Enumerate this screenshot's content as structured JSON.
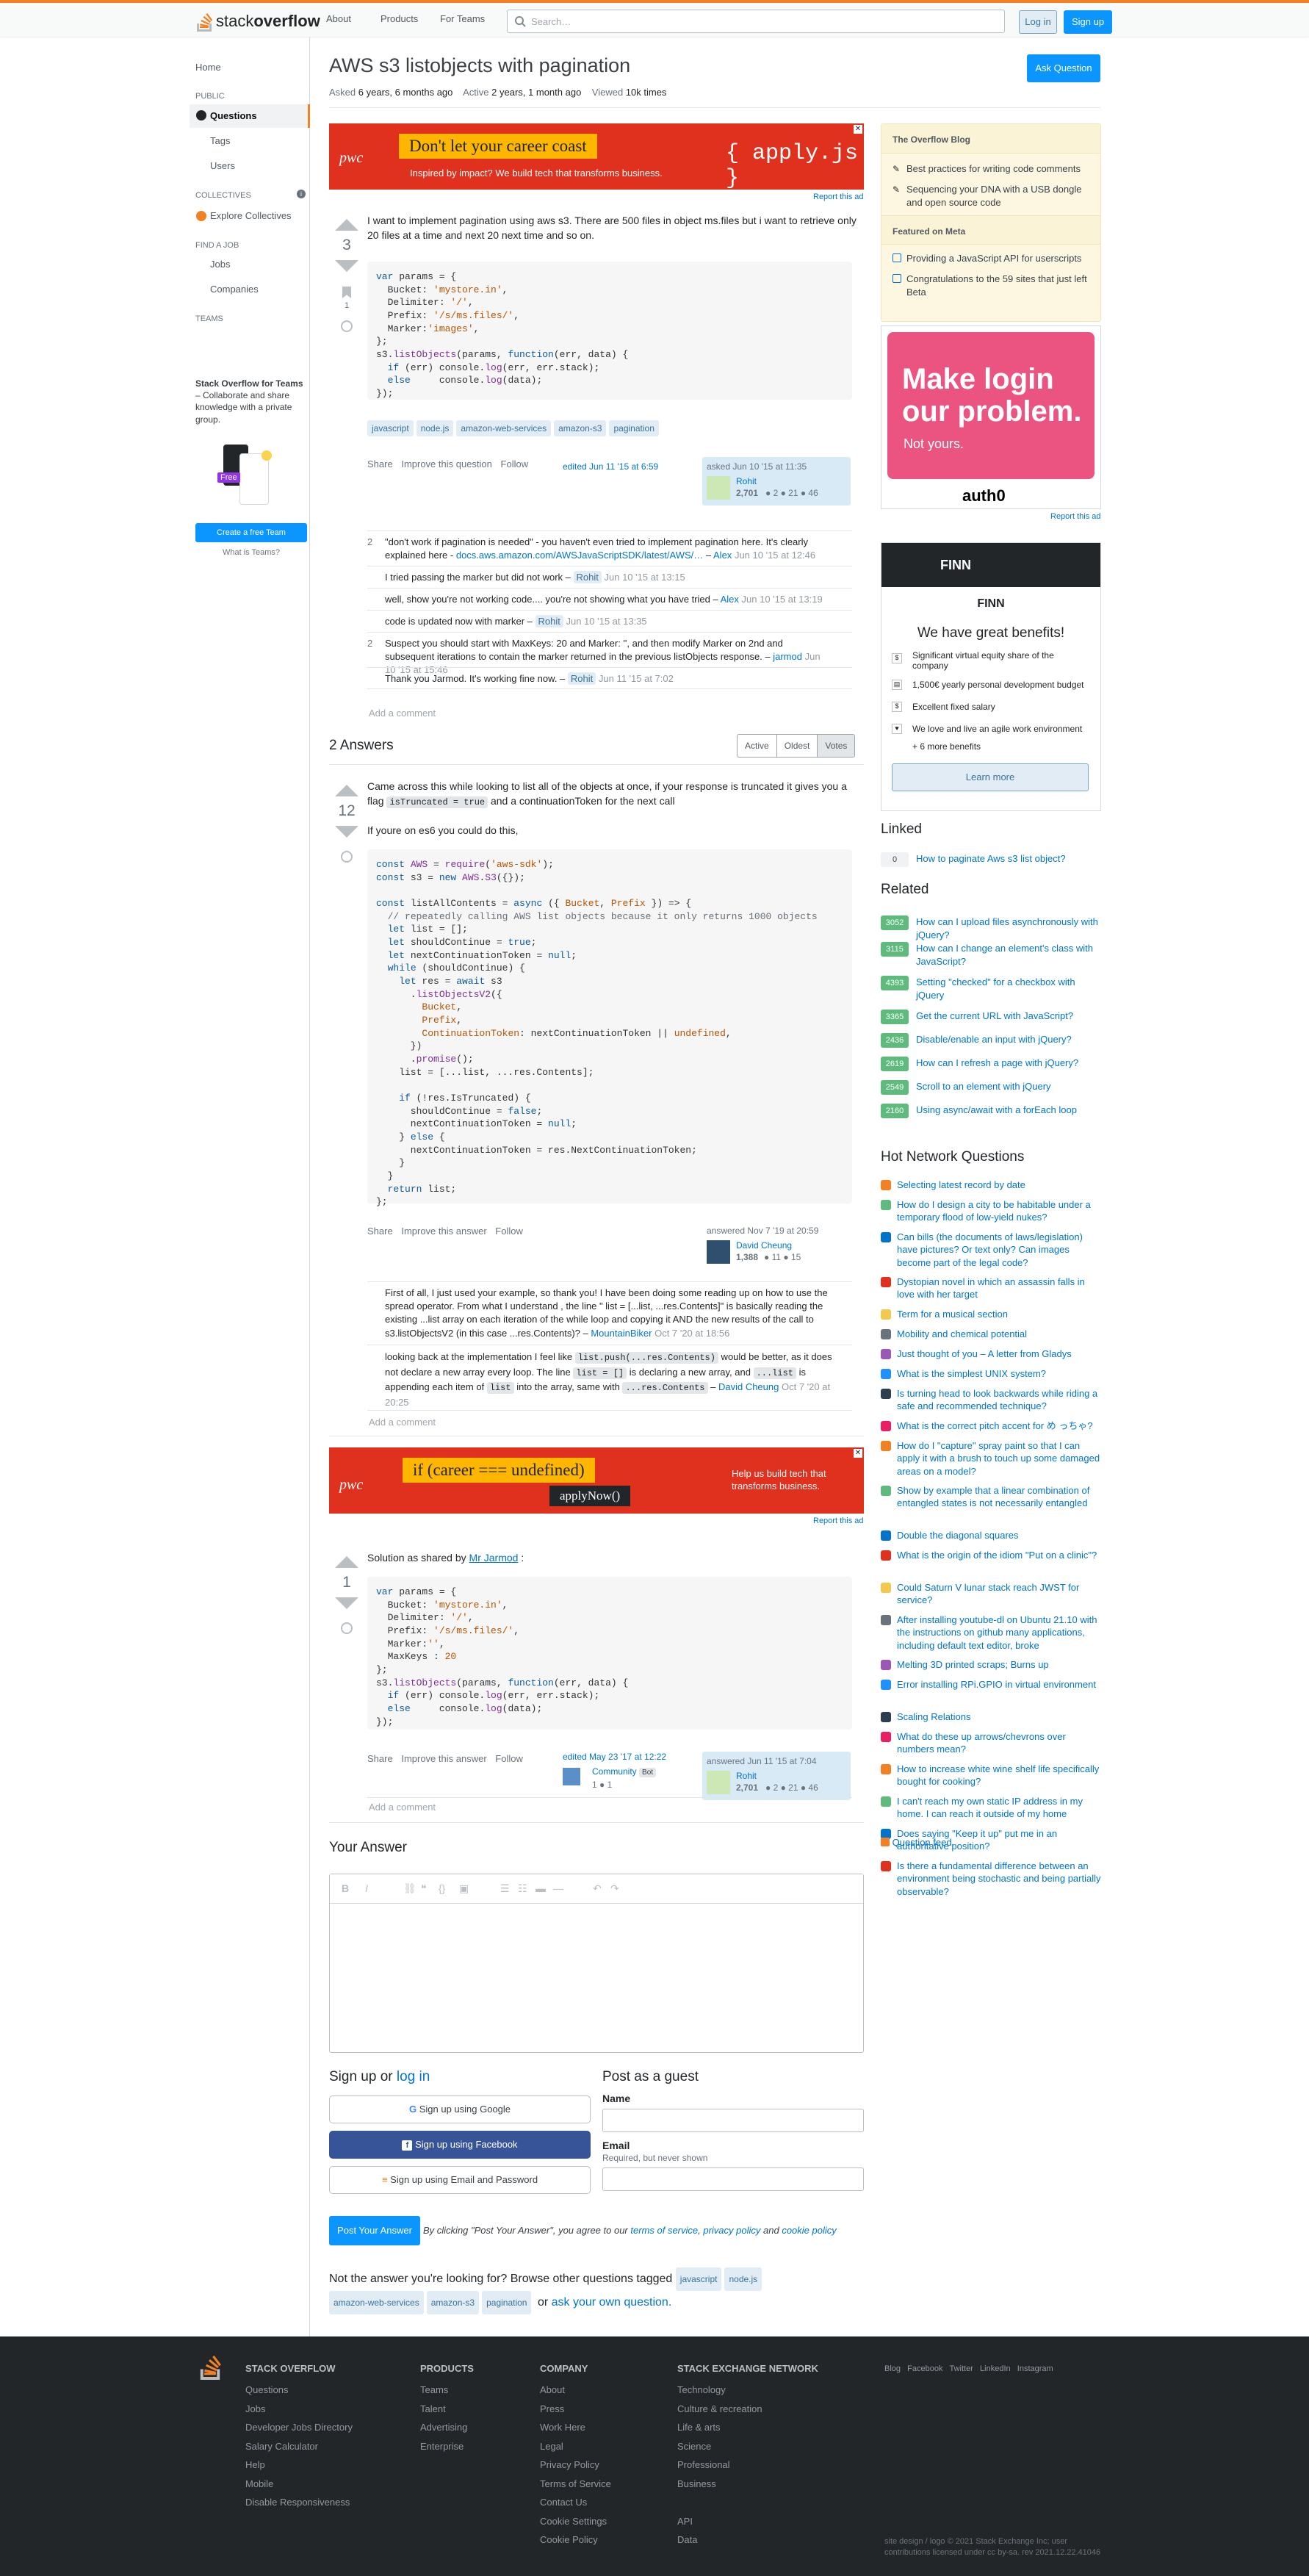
{
  "topbar": {
    "logo_text_a": "stack",
    "logo_text_b": "overflow",
    "nav": [
      "About",
      "Products",
      "For Teams"
    ],
    "search_placeholder": "Search…",
    "login": "Log in",
    "signup": "Sign up"
  },
  "leftnav": {
    "home": "Home",
    "public": "PUBLIC",
    "questions": "Questions",
    "tags": "Tags",
    "users": "Users",
    "collectives": "COLLECTIVES",
    "explore_collectives": "Explore Collectives",
    "find_job": "FIND A JOB",
    "jobs": "Jobs",
    "companies": "Companies",
    "teams": "TEAMS",
    "teams_title": "Stack Overflow for Teams",
    "teams_desc": " – Collaborate and share knowledge with a private group.",
    "free_badge": "Free",
    "create_team": "Create a free Team",
    "what_is_teams": "What is Teams?"
  },
  "question": {
    "title": "AWS s3 listobjects with pagination",
    "ask_button": "Ask Question",
    "asked_label": "Asked",
    "asked_value": "6 years, 6 months ago",
    "active_label": "Active",
    "active_value": "2 years, 1 month ago",
    "viewed_label": "Viewed",
    "viewed_value": "10k times",
    "votes": "3",
    "bookmark_count": "1",
    "body": "I want to implement pagination using aws s3. There are 500 files in object ms.files but i want to retrieve only 20 files at a time and next 20 next time and so on.",
    "tags": [
      "javascript",
      "node.js",
      "amazon-web-services",
      "amazon-s3",
      "pagination"
    ],
    "actions": [
      "Share",
      "Improve this question",
      "Follow"
    ],
    "edited": "edited Jun 11 '15 at 6:59",
    "asked_card": "asked Jun 10 '15 at 11:35",
    "user": "Rohit",
    "user_rep": "2,701",
    "user_badges": "● 2  ● 21  ● 46",
    "add_comment": "Add a comment"
  },
  "ad1": {
    "headline": "Don't let your career coast",
    "sub": "Inspired by impact? We build tech that transforms business.",
    "code": "{ apply.js }",
    "brand": "pwc",
    "report": "Report this ad"
  },
  "q_comments": [
    {
      "score": "2",
      "text": "\"don't work if pagination is needed\" - you haven't even tried to implement pagination here. It's clearly explained here - ",
      "link": "docs.aws.amazon.com/AWSJavaScriptSDK/latest/AWS/…",
      "user": "Alex",
      "date": "Jun 10 '15 at 12:46"
    },
    {
      "score": "",
      "text": "I tried passing the marker but did not work – ",
      "link": "",
      "user": "Rohit",
      "date": "Jun 10 '15 at 13:15"
    },
    {
      "score": "",
      "text": "well, show you're not working code.... you're not showing what you have tried – ",
      "link": "",
      "user": "Alex",
      "date": "Jun 10 '15 at 13:19"
    },
    {
      "score": "",
      "text": "code is updated now with marker – ",
      "link": "",
      "user": "Rohit",
      "date": "Jun 10 '15 at 13:35"
    },
    {
      "score": "2",
      "text": "Suspect you should start with MaxKeys: 20 and Marker: '', and then modify Marker on 2nd and subsequent iterations to contain the marker returned in the previous listObjects response. – ",
      "link": "",
      "user": "jarmod",
      "date": "Jun 10 '15 at 15:46"
    },
    {
      "score": "",
      "text": "Thank you Jarmod. It's working fine now. – ",
      "link": "",
      "user": "Rohit",
      "date": "Jun 11 '15 at 7:02"
    }
  ],
  "answers_header": {
    "count": "2 Answers",
    "sort": [
      "Active",
      "Oldest",
      "Votes"
    ]
  },
  "answer1": {
    "votes": "12",
    "p1a": "Came across this while looking to list all of the objects at once, if your response is truncated it gives you a flag ",
    "p1code": "isTruncated = true",
    "p1b": " and a continuationToken for the next call",
    "p2": "If youre on es6 you could do this,",
    "actions": [
      "Share",
      "Improve this answer",
      "Follow"
    ],
    "answered": "answered Nov 7 '19 at 20:59",
    "user": "David Cheung",
    "user_rep": "1,388",
    "user_badges": "● 11  ● 15",
    "add_comment": "Add a comment",
    "comment1": "First of all, I just used your example, so thank you! I have been doing some reading up on how to use the spread operator. From what I understand , the line \" list = [...list, ...res.Contents]\" is basically reading the existing ...list array on each iteration of the while loop and copying it AND the new results of the call to s3.listObjectsV2 (in this case ...res.Contents)? – ",
    "comment1_user": "MountainBiker",
    "comment1_date": "Oct 7 '20 at 18:56",
    "comment2a": "looking back at the implementation I feel like ",
    "comment2code1": "list.push(...res.Contents)",
    "comment2b": " would be better, as it does not declare a new array every loop. The line ",
    "comment2code2": "list = []",
    "comment2c": " is declaring a new array, and ",
    "comment2code3": "...list",
    "comment2d": " is appending each item of ",
    "comment2code4": "list",
    "comment2e": " into the array, same with ",
    "comment2code5": "...res.Contents",
    "comment2f": " – ",
    "comment2_user": "David Cheung",
    "comment2_date": "Oct 7 '20 at 20:25"
  },
  "ad2": {
    "headline": "if (career === undefined)",
    "sub": "Help us build tech that transforms business.",
    "button": "applyNow()",
    "brand": "pwc",
    "report": "Report this ad"
  },
  "answer2": {
    "votes": "1",
    "body_a": "Solution as shared by ",
    "body_link": "Mr Jarmod",
    "body_b": " :",
    "actions": [
      "Share",
      "Improve this answer",
      "Follow"
    ],
    "edited": "edited May 23 '17 at 12:22",
    "community": "Community",
    "bot": "Bot",
    "community_rep": "1  ● 1",
    "answered": "answered Jun 11 '15 at 7:04",
    "user": "Rohit",
    "user_rep": "2,701",
    "user_badges": "● 2  ● 21  ● 46",
    "add_comment": "Add a comment"
  },
  "your_answer": {
    "title": "Your Answer",
    "signup_title_a": "Sign up or ",
    "signup_title_link": "log in",
    "google": "Sign up using Google",
    "facebook": "Sign up using Facebook",
    "email": "Sign up using Email and Password",
    "guest_title": "Post as a guest",
    "name_label": "Name",
    "email_label": "Email",
    "email_note": "Required, but never shown",
    "post_button": "Post Your Answer",
    "terms_a": "By clicking \"Post Your Answer\", you agree to our ",
    "terms_link1": "terms of service",
    "terms_b": ", ",
    "terms_link2": "privacy policy",
    "terms_c": " and ",
    "terms_link3": "cookie policy",
    "not_answer": "Not the answer you're looking for? Browse other questions tagged",
    "tags": [
      "javascript",
      "node.js",
      "amazon-web-services",
      "amazon-s3",
      "pagination"
    ],
    "or": "or",
    "ask_own": "ask your own question."
  },
  "sidebar": {
    "blog_head": "The Overflow Blog",
    "blog_items": [
      "Best practices for writing code comments",
      "Sequencing your DNA with a USB dongle and open source code"
    ],
    "meta_head": "Featured on Meta",
    "meta_items": [
      "Providing a JavaScript API for userscripts",
      "Congratulations to the 59 sites that just left Beta"
    ],
    "ad_title": "Make login our problem.",
    "ad_sub": "Not yours.",
    "ad_brand": "auth0",
    "report": "Report this ad",
    "finn_brand": "FINN",
    "finn_name": "FINN",
    "finn_title": "We have great benefits!",
    "finn_items": [
      "Significant virtual equity share of the company",
      "1,500€ yearly personal development budget",
      "Excellent fixed salary",
      "We love and live an agile work environment"
    ],
    "finn_more": "+ 6 more benefits",
    "finn_button": "Learn more",
    "linked_title": "Linked",
    "linked": [
      {
        "score": "0",
        "title": "How to paginate Aws s3 list object?"
      }
    ],
    "related_title": "Related",
    "related": [
      {
        "score": "3052",
        "title": "How can I upload files asynchronously with jQuery?"
      },
      {
        "score": "3115",
        "title": "How can I change an element's class with JavaScript?"
      },
      {
        "score": "4393",
        "title": "Setting \"checked\" for a checkbox with jQuery"
      },
      {
        "score": "3365",
        "title": "Get the current URL with JavaScript?"
      },
      {
        "score": "2436",
        "title": "Disable/enable an input with jQuery?"
      },
      {
        "score": "2619",
        "title": "How can I refresh a page with jQuery?"
      },
      {
        "score": "2549",
        "title": "Scroll to an element with jQuery"
      },
      {
        "score": "2160",
        "title": "Using async/await with a forEach loop"
      }
    ],
    "hnq_title": "Hot Network Questions",
    "hnq": [
      "Selecting latest record by date",
      "How do I design a city to be habitable under a temporary flood of low-yield nukes?",
      "Can bills (the documents of laws/legislation) have pictures? Or text only? Can images become part of the legal code?",
      "Dystopian novel in which an assassin falls in love with her target",
      "Term for a musical section",
      "Mobility and chemical potential",
      "Just thought of you – A letter from Gladys",
      "What is the simplest UNIX system?",
      "Is turning head to look backwards while riding a safe and recommended technique?",
      "What is the correct pitch accent for め っちゃ?",
      "How do I \"capture\" spray paint so that I can apply it with a brush to touch up some damaged areas on a model?",
      "Show by example that a linear combination of entangled states is not necessarily entangled",
      "Double the diagonal squares",
      "What is the origin of the idiom \"Put on a clinic\"?",
      "Could Saturn V lunar stack reach JWST for service?",
      "After installing youtube-dl on Ubuntu 21.10 with the instructions on github many applications, including default text editor, broke",
      "Melting 3D printed scraps; Burns up",
      "Error installing RPi.GPIO in virtual environment",
      "Scaling Relations",
      "What do these up arrows/chevrons over numbers mean?",
      "How to increase white wine shelf life specifically bought for cooking?",
      "I can't reach my own static IP address in my home. I can reach it outside of my home",
      "Does saying \"Keep it up\" put me in an authoritative position?",
      "Is there a fundamental difference between an environment being stochastic and being partially observable?"
    ],
    "question_feed": "Question feed"
  },
  "footer": {
    "col1_head": "STACK OVERFLOW",
    "col1": [
      "Questions",
      "Jobs",
      "Developer Jobs Directory",
      "Salary Calculator",
      "Help",
      "Mobile",
      "Disable Responsiveness"
    ],
    "col2_head": "PRODUCTS",
    "col2": [
      "Teams",
      "Talent",
      "Advertising",
      "Enterprise"
    ],
    "col3_head": "COMPANY",
    "col3": [
      "About",
      "Press",
      "Work Here",
      "Legal",
      "Privacy Policy",
      "Terms of Service",
      "Contact Us",
      "Cookie Settings",
      "Cookie Policy"
    ],
    "col4_head": "STACK EXCHANGE NETWORK",
    "col4": [
      "Technology",
      "Culture & recreation",
      "Life & arts",
      "Science",
      "Professional",
      "Business",
      "",
      "API",
      "Data"
    ],
    "social": "Blog   Facebook   Twitter   LinkedIn   Instagram",
    "copyright": "site design / logo © 2021 Stack Exchange Inc; user contributions licensed under cc by-sa. rev 2021.12.22.41046"
  }
}
